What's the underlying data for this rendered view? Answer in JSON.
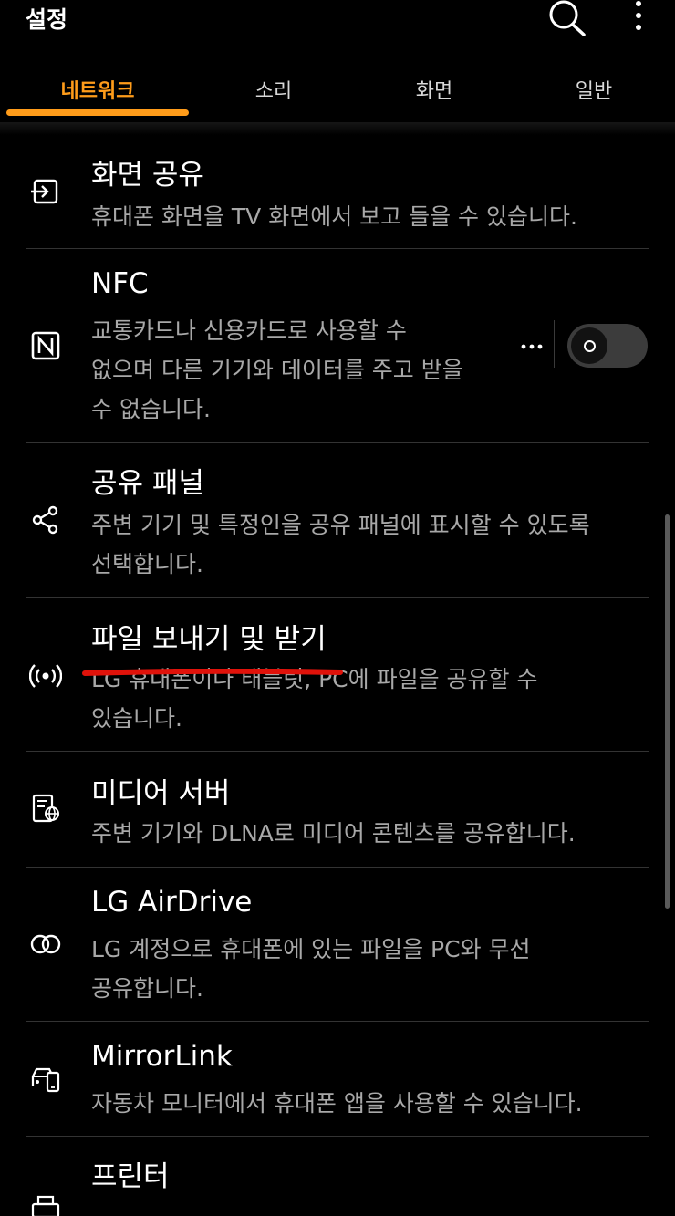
{
  "app": {
    "title": "설정"
  },
  "icons": {
    "search": "search-icon",
    "more": "more-vert-icon"
  },
  "tabs": [
    {
      "label": "네트워크",
      "active": true
    },
    {
      "label": "소리",
      "active": false
    },
    {
      "label": "화면",
      "active": false
    },
    {
      "label": "일반",
      "active": false
    }
  ],
  "colors": {
    "accent": "#ff9c1a",
    "background": "#000000",
    "annotation": "#e0120a"
  },
  "items": [
    {
      "title": "화면 공유",
      "desc": [
        "휴대폰 화면을 TV 화면에서 보고 들을 수 있습니다."
      ],
      "icon": "screen-share-icon"
    },
    {
      "title": "NFC",
      "desc": [
        "교통카드나 신용카드로 사용할 수",
        "없으며 다른 기기와 데이터를 주고 받을",
        "수 없습니다."
      ],
      "icon": "nfc-icon",
      "switch_on": false
    },
    {
      "title": "공유 패널",
      "desc": [
        "주변 기기 및 특정인을 공유 패널에 표시할 수 있도록",
        "선택합니다."
      ],
      "icon": "share-icon"
    },
    {
      "title": "파일 보내기 및 받기",
      "desc": [
        "LG 휴대폰이나 태블릿, PC에 파일을 공유할 수",
        "있습니다."
      ],
      "icon": "wireless-broadcast-icon"
    },
    {
      "title": "미디어 서버",
      "desc": [
        "주변 기기와 DLNA로 미디어 콘텐츠를 공유합니다."
      ],
      "icon": "media-server-icon"
    },
    {
      "title": "LG AirDrive",
      "desc": [
        "LG 계정으로 휴대폰에 있는 파일을 PC와 무선",
        "공유합니다."
      ],
      "icon": "airdrive-rings-icon"
    },
    {
      "title": "MirrorLink",
      "desc": [
        "자동차 모니터에서 휴대폰 앱을 사용할 수 있습니다."
      ],
      "icon": "car-phone-icon"
    },
    {
      "title": "프린터",
      "desc": [],
      "icon": "printer-icon"
    }
  ]
}
